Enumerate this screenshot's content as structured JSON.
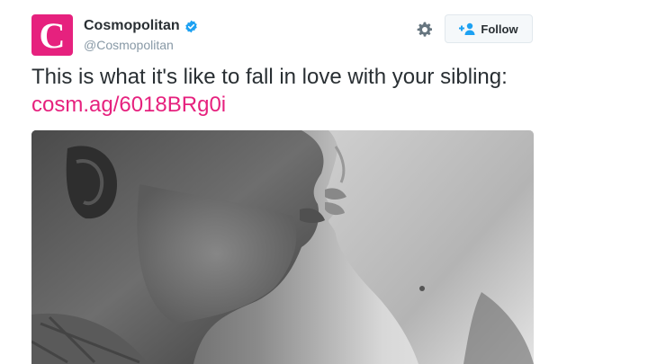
{
  "account": {
    "avatar_letter": "C",
    "display_name": "Cosmopolitan",
    "handle": "@Cosmopolitan",
    "verified": true,
    "brand_color": "#e6217e"
  },
  "actions": {
    "settings_icon": "gear-icon",
    "follow_icon": "add-user-icon",
    "follow_label": "Follow"
  },
  "tweet": {
    "text": "This is what it's like to fall in love with your sibling: ",
    "link": "cosm.ag/6018BRg0i",
    "media_description_icon": "photo"
  }
}
